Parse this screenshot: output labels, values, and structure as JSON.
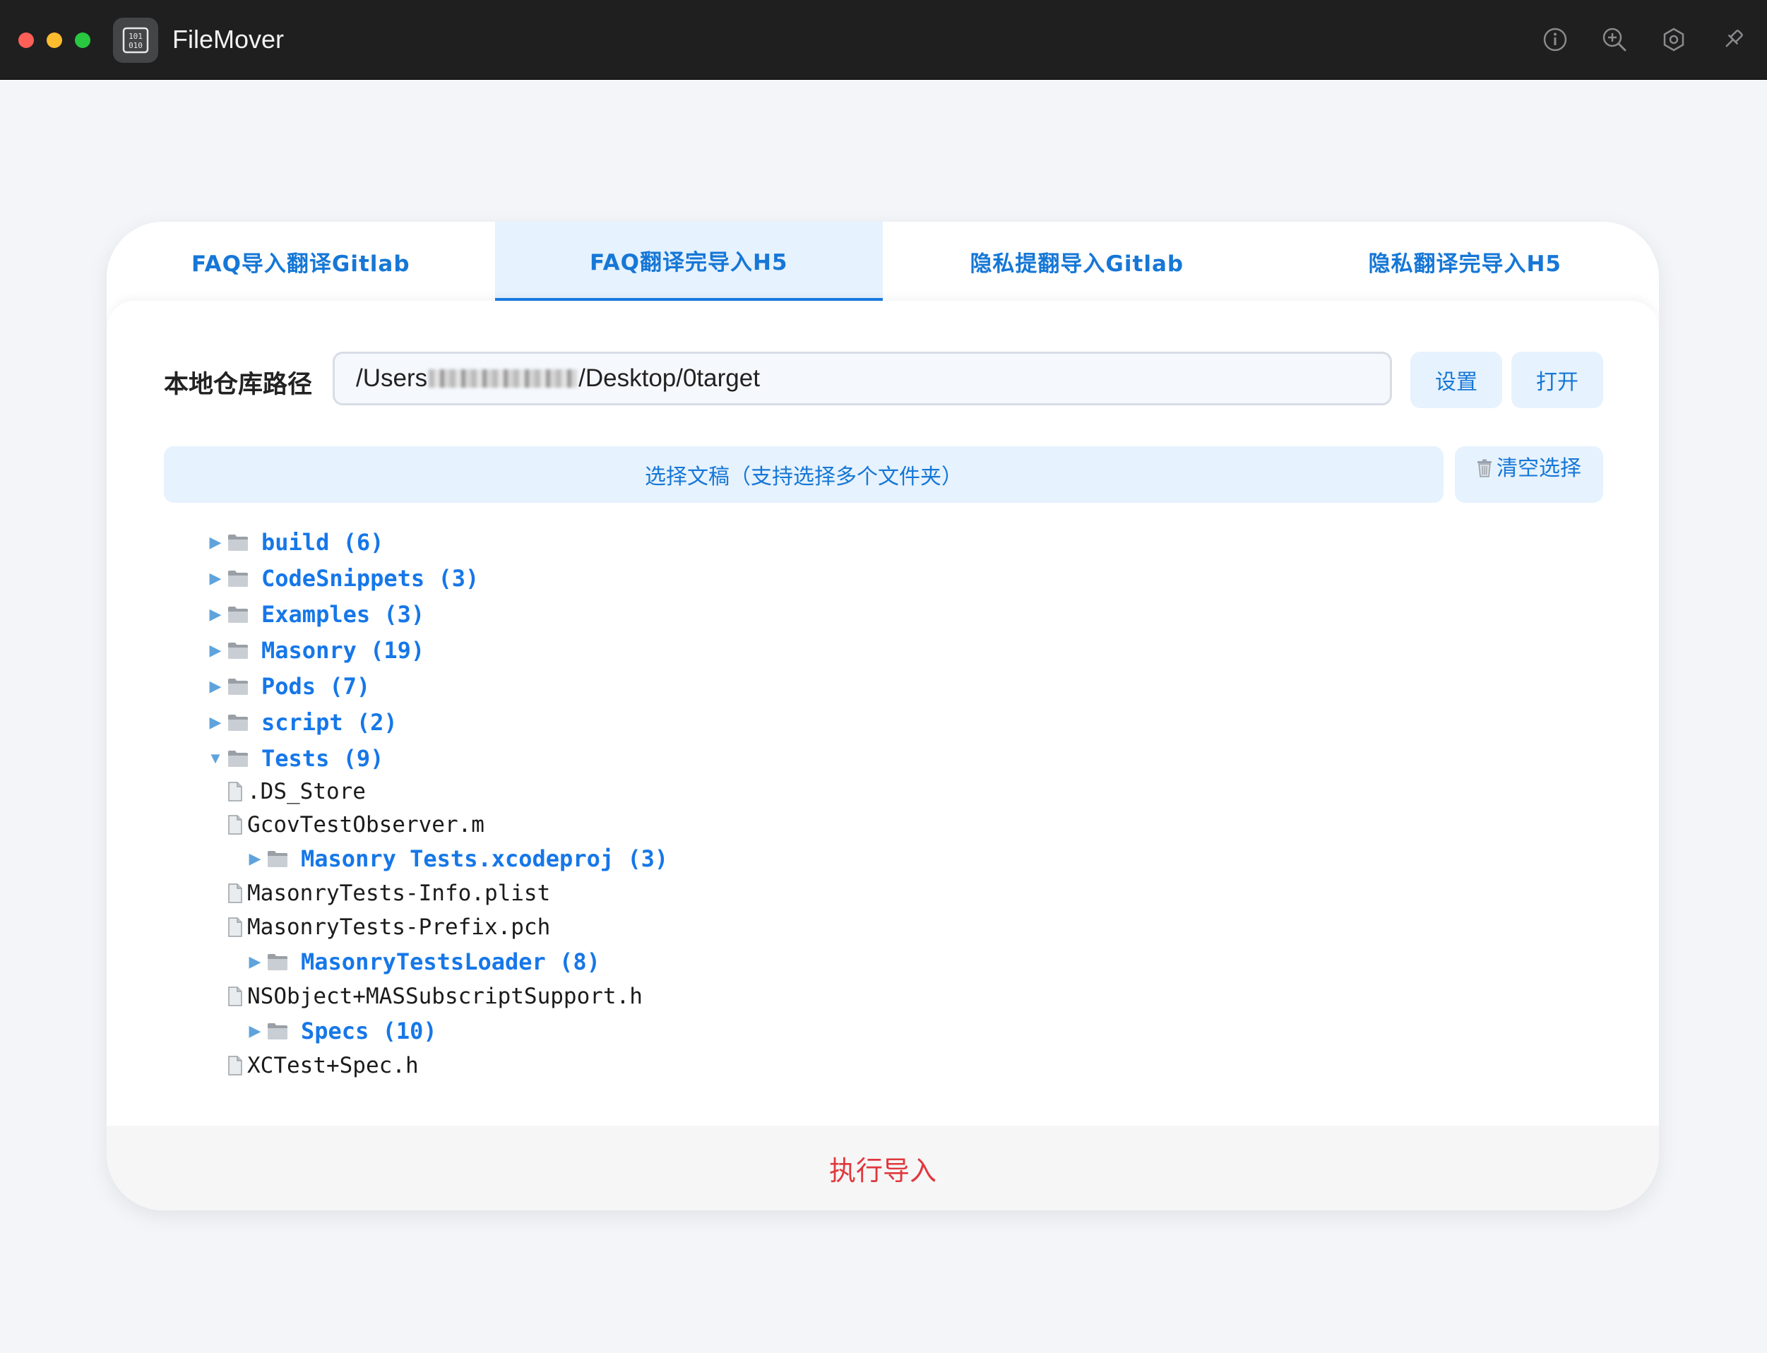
{
  "app": {
    "title": "FileMover"
  },
  "titlebar_icons": [
    "info-icon",
    "zoom-in-icon",
    "settings-hexagon-icon",
    "pin-icon"
  ],
  "tabs": [
    {
      "label": "FAQ导入翻译Gitlab",
      "active": false
    },
    {
      "label": "FAQ翻译完导入H5",
      "active": true
    },
    {
      "label": "隐私提翻导入Gitlab",
      "active": false
    },
    {
      "label": "隐私翻译完导入H5",
      "active": false
    }
  ],
  "path": {
    "label": "本地仓库路径",
    "value_prefix": "/Users",
    "value_suffix": "/Desktop/0target",
    "set_label": "设置",
    "open_label": "打开"
  },
  "select": {
    "label": "选择文稿（支持选择多个文件夹）",
    "clear_label": "清空选择"
  },
  "tree": [
    {
      "type": "folder",
      "name": "build (6)",
      "expanded": false,
      "depth": 0
    },
    {
      "type": "folder",
      "name": "CodeSnippets (3)",
      "expanded": false,
      "depth": 0
    },
    {
      "type": "folder",
      "name": "Examples (3)",
      "expanded": false,
      "depth": 0
    },
    {
      "type": "folder",
      "name": "Masonry (19)",
      "expanded": false,
      "depth": 0
    },
    {
      "type": "folder",
      "name": "Pods (7)",
      "expanded": false,
      "depth": 0
    },
    {
      "type": "folder",
      "name": "script (2)",
      "expanded": false,
      "depth": 0
    },
    {
      "type": "folder",
      "name": "Tests (9)",
      "expanded": true,
      "depth": 0
    },
    {
      "type": "file",
      "name": ".DS_Store",
      "depth": 1
    },
    {
      "type": "file",
      "name": "GcovTestObserver.m",
      "depth": 1
    },
    {
      "type": "folder",
      "name": "Masonry Tests.xcodeproj (3)",
      "expanded": false,
      "depth": 1
    },
    {
      "type": "file",
      "name": "MasonryTests-Info.plist",
      "depth": 1
    },
    {
      "type": "file",
      "name": "MasonryTests-Prefix.pch",
      "depth": 1
    },
    {
      "type": "folder",
      "name": "MasonryTestsLoader (8)",
      "expanded": false,
      "depth": 1
    },
    {
      "type": "file",
      "name": "NSObject+MASSubscriptSupport.h",
      "depth": 1
    },
    {
      "type": "folder",
      "name": "Specs (10)",
      "expanded": false,
      "depth": 1
    },
    {
      "type": "file",
      "name": "XCTest+Spec.h",
      "depth": 1
    }
  ],
  "footer": {
    "action_label": "执行导入"
  },
  "colors": {
    "accent": "#1677d6",
    "tab_active_bg": "#e6f2fd",
    "danger": "#e0383e",
    "titlebar": "#1f1f20"
  }
}
